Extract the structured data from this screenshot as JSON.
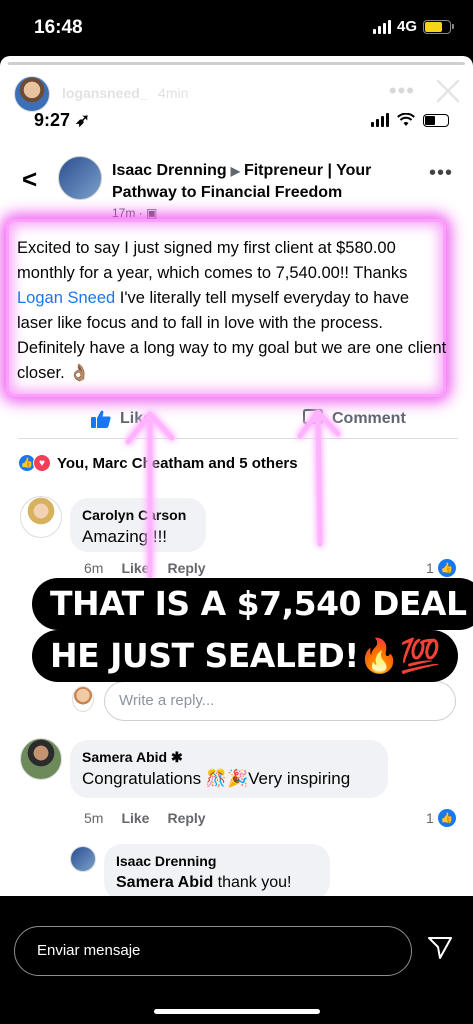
{
  "os_status": {
    "time": "16:48",
    "network": "4G"
  },
  "story": {
    "username": "logansneed_",
    "age": "4min",
    "more_label": "•••",
    "progress": 0.98
  },
  "inner_status": {
    "time": "9:27 ➶"
  },
  "post": {
    "back_label": "<",
    "author": "Isaac Drenning",
    "arrow": "▶",
    "group": "Fitpreneur | Your Pathway to Financial Freedom",
    "meta": "17m · ▣",
    "more_label": "•••",
    "text_before": "Excited to say I just signed my first client at $580.00 monthly for a year, which comes to 7,540.00!! Thanks ",
    "mention": "Logan Sneed",
    "text_after": " I've literally tell myself everyday to have laser like focus and to fall in love with the process. Definitely have a long way to my goal but we are one client closer. 👌🏽",
    "like_label": "Like",
    "comment_label": "Comment",
    "reactions_text": "You, Marc Cheatham and 5 others"
  },
  "comments": [
    {
      "name": "Carolyn Carson",
      "text": "Amazing!!!!",
      "time": "6m",
      "like_label": "Like",
      "reply_label": "Reply",
      "likes": "1"
    },
    {
      "name": "Samera Abid ✱",
      "text": "Congratulations 🎊🎉Very inspiring",
      "time": "5m",
      "like_label": "Like",
      "reply_label": "Reply",
      "likes": "1"
    }
  ],
  "reply_placeholder": "Write a reply...",
  "reply": {
    "name": "Isaac Drenning",
    "mention": "Samera Abid",
    "text": " thank you!"
  },
  "caption": {
    "line1": "THAT IS A $7,540 DEAL",
    "line2": "HE JUST SEALED!🔥💯"
  },
  "bottom": {
    "message_placeholder": "Enviar mensaje"
  },
  "colors": {
    "facebook_blue": "#1877f2",
    "glow": "#eb3ceb",
    "story_bg": "#ffffff",
    "battery": "#f5d41a"
  }
}
